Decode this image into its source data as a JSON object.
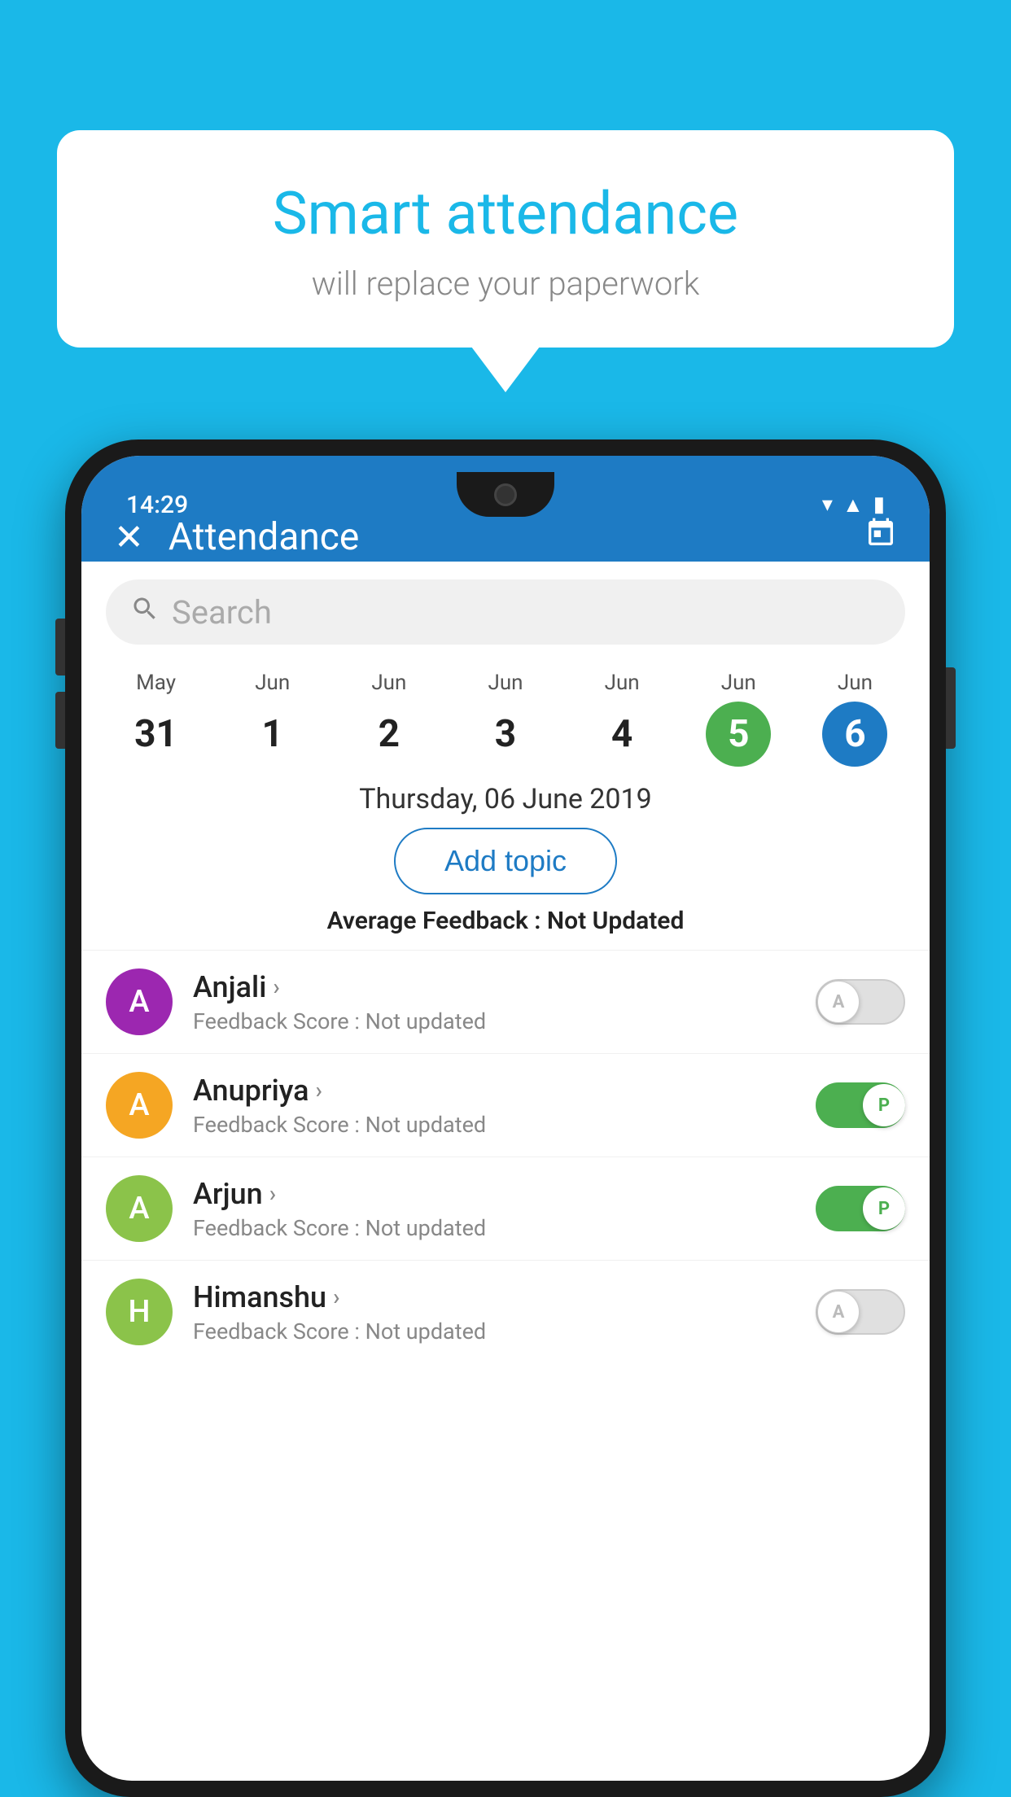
{
  "background_color": "#1ab8e8",
  "bubble": {
    "title": "Smart attendance",
    "subtitle": "will replace your paperwork"
  },
  "phone": {
    "time": "14:29",
    "header": {
      "title": "Attendance",
      "close_label": "✕",
      "calendar_label": "📅"
    },
    "search": {
      "placeholder": "Search"
    },
    "calendar": {
      "dates": [
        {
          "month": "May",
          "day": "31",
          "state": "normal"
        },
        {
          "month": "Jun",
          "day": "1",
          "state": "normal"
        },
        {
          "month": "Jun",
          "day": "2",
          "state": "normal"
        },
        {
          "month": "Jun",
          "day": "3",
          "state": "normal"
        },
        {
          "month": "Jun",
          "day": "4",
          "state": "normal"
        },
        {
          "month": "Jun",
          "day": "5",
          "state": "today"
        },
        {
          "month": "Jun",
          "day": "6",
          "state": "selected"
        }
      ]
    },
    "selected_date": "Thursday, 06 June 2019",
    "add_topic_label": "Add topic",
    "avg_feedback_label": "Average Feedback : ",
    "avg_feedback_value": "Not Updated",
    "students": [
      {
        "name": "Anjali",
        "feedback_label": "Feedback Score : ",
        "feedback_value": "Not updated",
        "avatar_letter": "A",
        "avatar_color": "#9c27b0",
        "toggle_state": "off",
        "toggle_letter": "A"
      },
      {
        "name": "Anupriya",
        "feedback_label": "Feedback Score : ",
        "feedback_value": "Not updated",
        "avatar_letter": "A",
        "avatar_color": "#f5a623",
        "toggle_state": "on",
        "toggle_letter": "P"
      },
      {
        "name": "Arjun",
        "feedback_label": "Feedback Score : ",
        "feedback_value": "Not updated",
        "avatar_letter": "A",
        "avatar_color": "#8bc34a",
        "toggle_state": "on",
        "toggle_letter": "P"
      },
      {
        "name": "Himanshu",
        "feedback_label": "Feedback Score : ",
        "feedback_value": "Not updated",
        "avatar_letter": "H",
        "avatar_color": "#8bc34a",
        "toggle_state": "off",
        "toggle_letter": "A"
      }
    ]
  }
}
